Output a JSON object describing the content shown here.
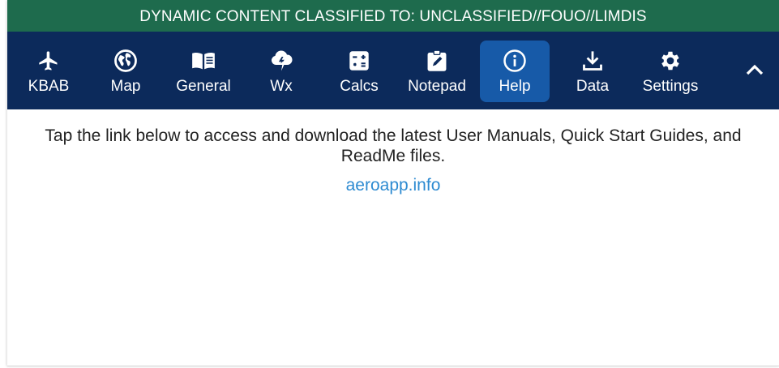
{
  "banner": {
    "text": "DYNAMIC CONTENT CLASSIFIED TO: UNCLASSIFIED//FOUO//LIMDIS"
  },
  "toolbar": {
    "tabs": [
      {
        "label": "KBAB",
        "icon": "airplane-icon"
      },
      {
        "label": "Map",
        "icon": "globe-icon"
      },
      {
        "label": "General",
        "icon": "book-icon"
      },
      {
        "label": "Wx",
        "icon": "storm-cloud-icon"
      },
      {
        "label": "Calcs",
        "icon": "calculator-icon"
      },
      {
        "label": "Notepad",
        "icon": "notepad-icon"
      },
      {
        "label": "Help",
        "icon": "info-icon",
        "active": true
      },
      {
        "label": "Data",
        "icon": "download-icon"
      },
      {
        "label": "Settings",
        "icon": "gear-icon"
      }
    ],
    "collapse_icon": "chevron-up-icon"
  },
  "content": {
    "intro": "Tap the link below to access and download the latest User Manuals, Quick Start Guides, and ReadMe files.",
    "link": "aeroapp.info"
  },
  "colors": {
    "banner": "#1e6b4d",
    "toolbar": "#0c2a5b",
    "active_tab": "#175aa8",
    "link": "#2e8bd1"
  }
}
